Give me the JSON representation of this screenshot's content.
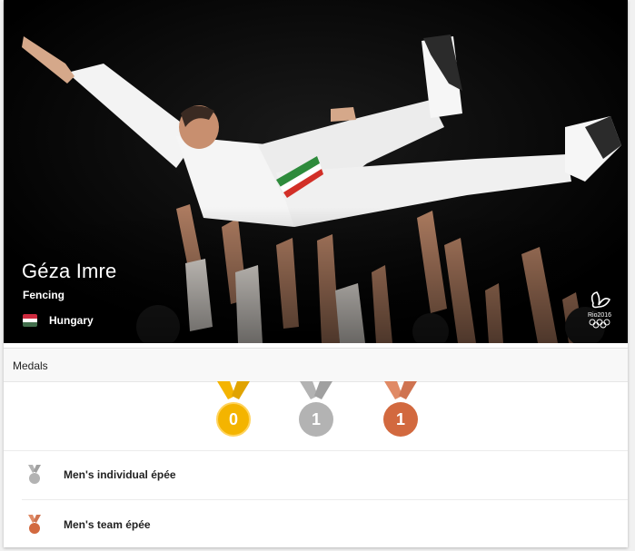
{
  "athlete": {
    "name": "Géza Imre",
    "sport": "Fencing",
    "country": "Hungary"
  },
  "hero": {
    "logo": "rio-2016-logo",
    "logo_text": "Rio2016"
  },
  "medals": {
    "title": "Medals",
    "counts": [
      {
        "type": "gold",
        "count": "0",
        "color": "#f4b400"
      },
      {
        "type": "silver",
        "count": "1",
        "color": "#b3b3b3"
      },
      {
        "type": "bronze",
        "count": "1",
        "color": "#d2693f"
      }
    ],
    "events": [
      {
        "medal": "silver",
        "name": "Men's individual épée",
        "icon": "silver-medal-icon"
      },
      {
        "medal": "bronze",
        "name": "Men's team épée",
        "icon": "bronze-medal-icon"
      }
    ]
  },
  "colors": {
    "gold": "#f4b400",
    "silver": "#b3b3b3",
    "bronze": "#d2693f",
    "flag_red": "#cd2a3e",
    "flag_white": "#ffffff",
    "flag_green": "#436f4d"
  }
}
